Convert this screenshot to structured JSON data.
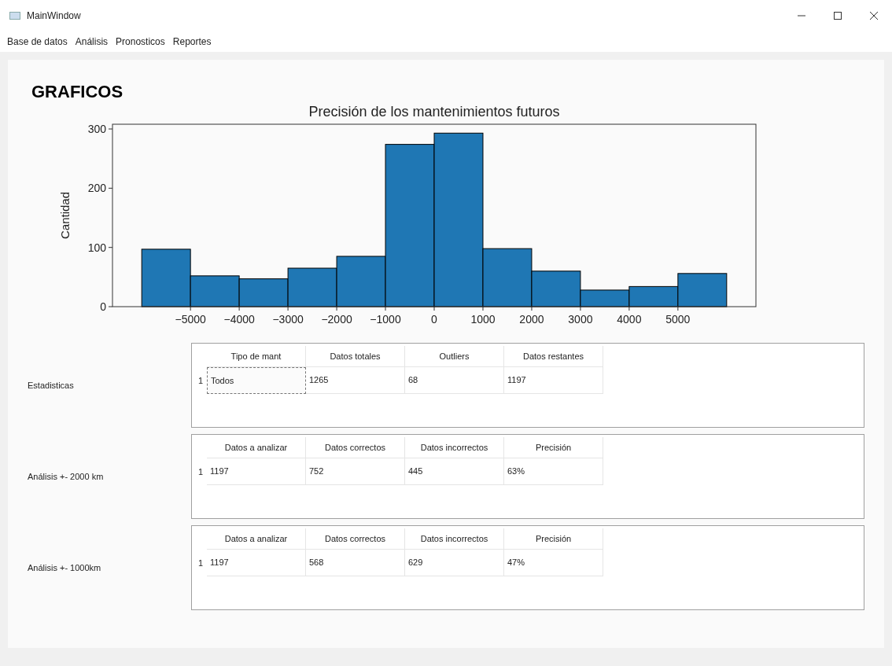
{
  "window": {
    "title": "MainWindow"
  },
  "menu": [
    "Base de datos",
    "Análisis",
    "Pronosticos",
    "Reportes"
  ],
  "heading": "GRAFICOS",
  "chart_data": {
    "type": "bar",
    "title": "Precisión de los mantenimientos futuros",
    "ylabel": "Cantidad",
    "x": [
      -5500,
      -4500,
      -3500,
      -2500,
      -1500,
      -500,
      500,
      1500,
      2500,
      3500,
      4500,
      5500
    ],
    "series": [
      {
        "color": "#1f77b4",
        "values": [
          97,
          52,
          47,
          65,
          85,
          274,
          293,
          98,
          60,
          28,
          34,
          56
        ]
      }
    ],
    "xlim": [
      -6600,
      6600
    ],
    "ylim": [
      0,
      308
    ],
    "xticks": [
      {
        "value": -5000,
        "label": "−5000"
      },
      {
        "value": -4000,
        "label": "−4000"
      },
      {
        "value": -3000,
        "label": "−3000"
      },
      {
        "value": -2000,
        "label": "−2000"
      },
      {
        "value": -1000,
        "label": "−1000"
      },
      0,
      1000,
      2000,
      3000,
      4000,
      5000
    ],
    "yticks": [
      0,
      100,
      200,
      300
    ]
  },
  "sections": [
    {
      "label": "Estadisticas",
      "columns": [
        "Tipo de mant",
        "Datos totales",
        "Outliers",
        "Datos restantes"
      ],
      "rows": [
        {
          "header": "1",
          "cells": [
            {
              "text": "Todos",
              "selected": true
            },
            {
              "text": "1265",
              "selected": false
            },
            {
              "text": "68",
              "selected": false
            },
            {
              "text": "1197",
              "selected": false
            }
          ]
        }
      ]
    },
    {
      "label": "Análisis +- 2000 km",
      "columns": [
        "Datos a analizar",
        "Datos correctos",
        "Datos incorrectos",
        "Precisión"
      ],
      "rows": [
        {
          "header": "1",
          "cells": [
            {
              "text": "1197",
              "selected": false
            },
            {
              "text": "752",
              "selected": false
            },
            {
              "text": "445",
              "selected": false
            },
            {
              "text": "63%",
              "selected": false
            }
          ]
        }
      ]
    },
    {
      "label": "Análisis +- 1000km",
      "columns": [
        "Datos a analizar",
        "Datos correctos",
        "Datos incorrectos",
        "Precisión"
      ],
      "rows": [
        {
          "header": "1",
          "cells": [
            {
              "text": "1197",
              "selected": false
            },
            {
              "text": "568",
              "selected": false
            },
            {
              "text": "629",
              "selected": false
            },
            {
              "text": "47%",
              "selected": false
            }
          ]
        }
      ]
    }
  ]
}
